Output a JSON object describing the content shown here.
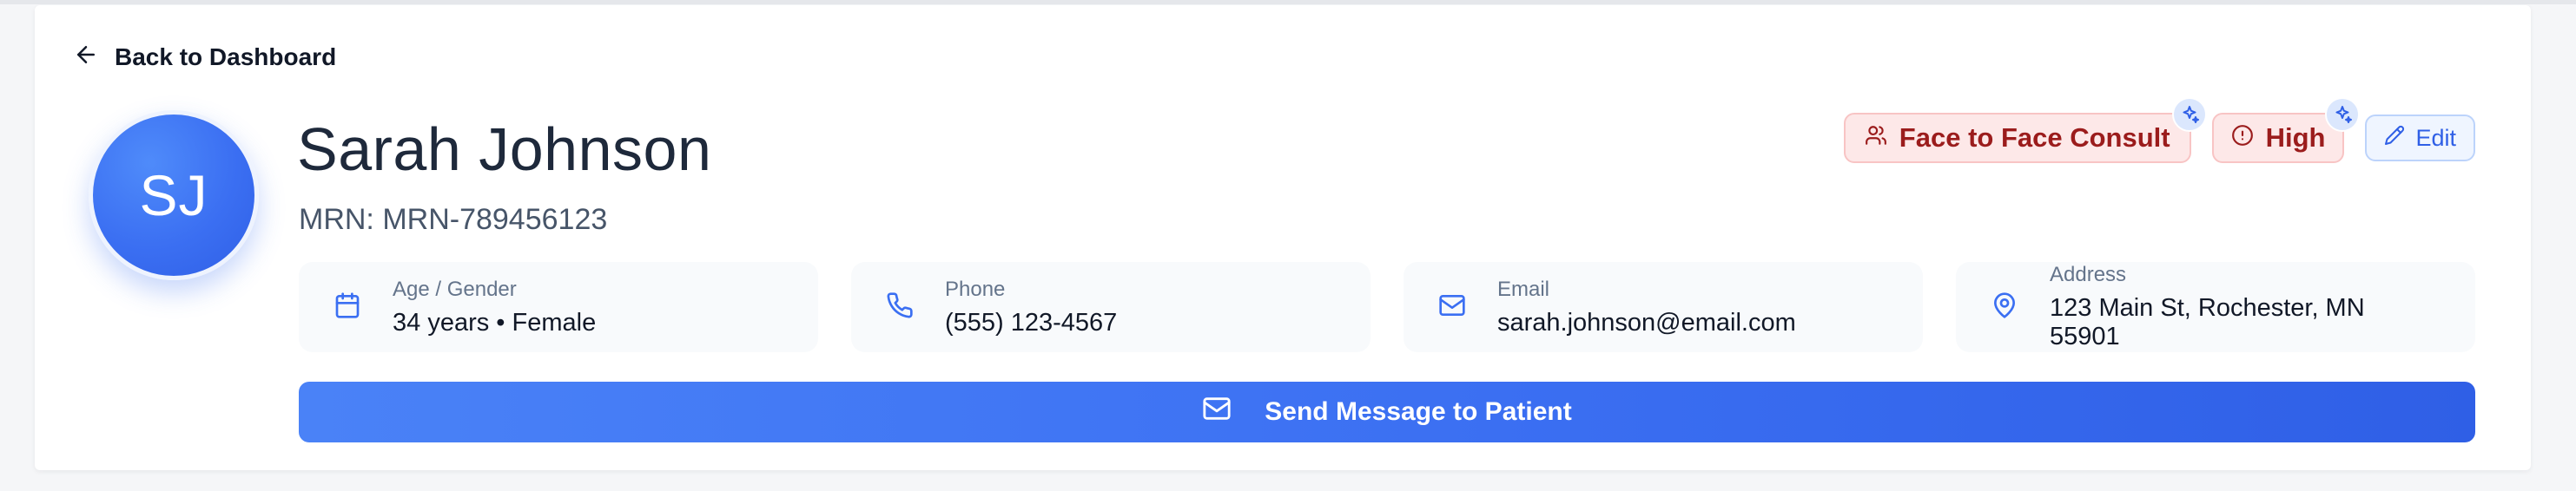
{
  "nav": {
    "back_label": "Back to Dashboard"
  },
  "patient": {
    "initials": "SJ",
    "name": "Sarah Johnson",
    "mrn_text": "MRN: MRN-789456123"
  },
  "badges": {
    "consult_label": "Face to Face Consult",
    "priority_label": "High",
    "edit_label": "Edit"
  },
  "info_cards": [
    {
      "label": "Age / Gender",
      "value": "34 years • Female",
      "icon": "calendar-icon"
    },
    {
      "label": "Phone",
      "value": "(555) 123-4567",
      "icon": "phone-icon"
    },
    {
      "label": "Email",
      "value": "sarah.johnson@email.com",
      "icon": "mail-icon"
    },
    {
      "label": "Address",
      "value": "123 Main St, Rochester, MN 55901",
      "icon": "map-pin-icon"
    }
  ],
  "actions": {
    "send_label": "Send Message to Patient"
  },
  "colors": {
    "accent": "#3b6ff2",
    "badge_bg": "#fde8e8",
    "badge_text": "#9b1c1c",
    "edit_text": "#2f5fe6"
  }
}
